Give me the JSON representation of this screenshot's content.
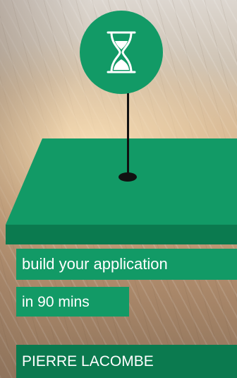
{
  "scene": {
    "badge_icon": "hourglass-icon",
    "colors": {
      "green_primary": "#129a66",
      "green_dark": "#0b7a4f",
      "pin": "#111111"
    }
  },
  "banners": {
    "line1": "build your application",
    "line2": "in 90 mins",
    "author": "PIERRE LACOMBE"
  }
}
